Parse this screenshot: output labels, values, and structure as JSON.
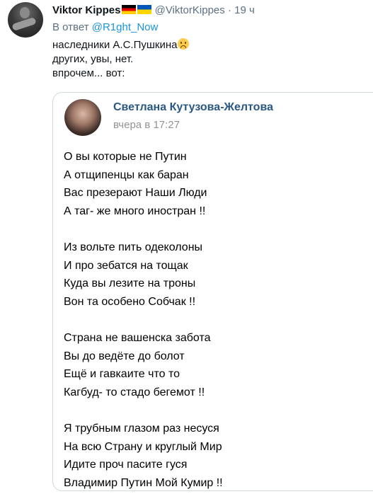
{
  "tweet": {
    "author_name": "Viktor Kippes",
    "handle": "@ViktorKippes",
    "separator": "·",
    "time": "19 ч",
    "reply_prefix": "В ответ",
    "reply_to": "@R1ght_Now",
    "lines": [
      "наследники А.С.Пушкина",
      "других, увы, нет.",
      "впрочем... вот:"
    ]
  },
  "card": {
    "author_name": "Светлана Кутузова-Желтова",
    "date": "вчера в 17:27",
    "stanzas": [
      [
        "О вы которые не Путин",
        "А отщипенцы как баран",
        "Вас презерают Наши Люди",
        "А таг- же много иностран !!"
      ],
      [
        "Из вольте пить одеколоны",
        "И про зебатся на тощак",
        "Куда вы лезите на троны",
        "Вон та особено Собчак !!"
      ],
      [
        "Страна не вашенска забота",
        "Вы до ведёте до болот",
        "Ещё и гавкаите что то",
        "Кагбуд- то стадо бегемот !!"
      ],
      [
        "Я трубным глазом раз несуся",
        "На всю Страну и круглый Мир",
        "Идите проч пасите гуся",
        "Владимир Путин Мой Кумир !!"
      ]
    ]
  }
}
